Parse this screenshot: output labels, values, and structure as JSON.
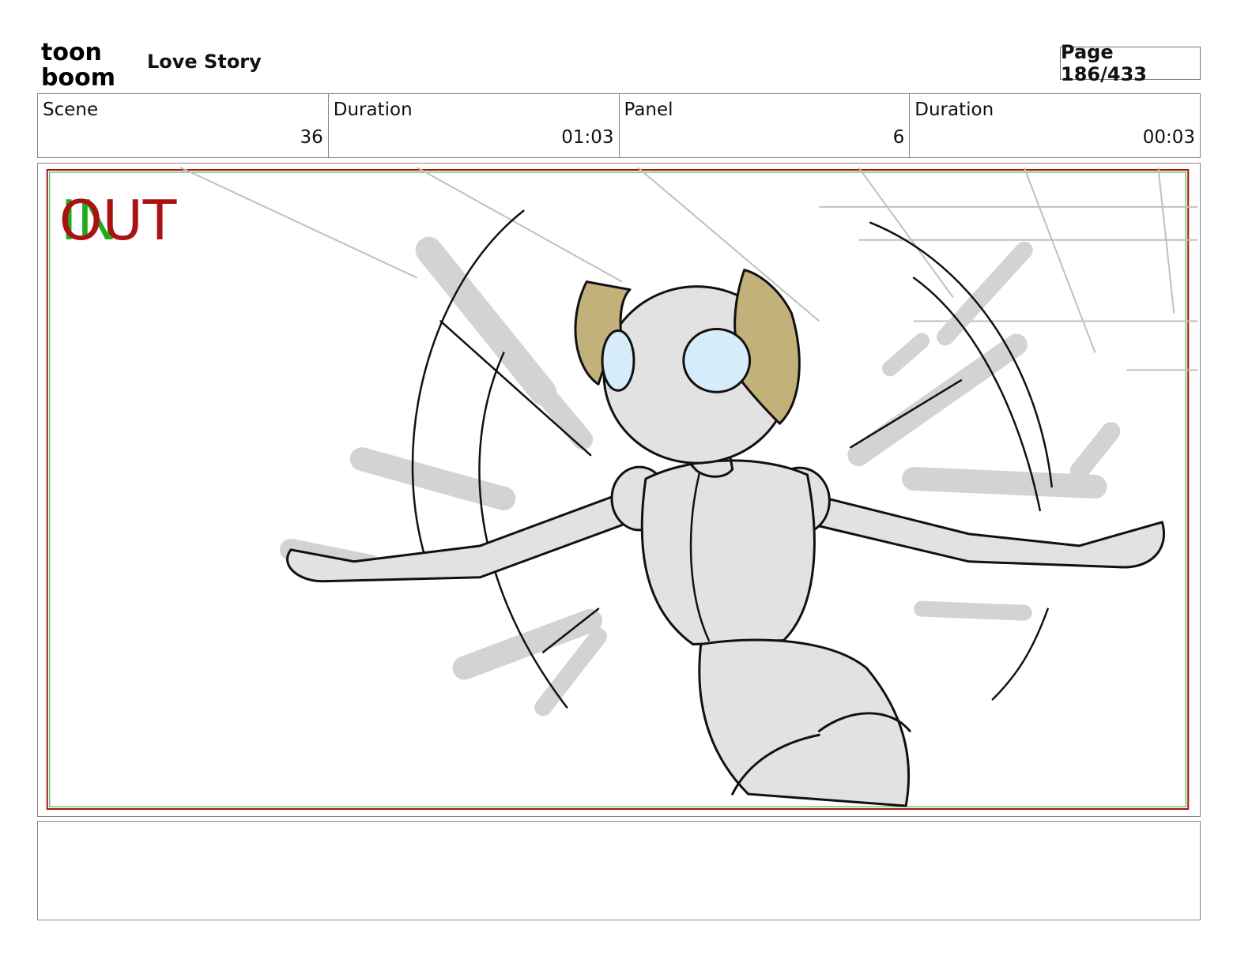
{
  "header": {
    "logo_top": "toon",
    "logo_bottom": "boom",
    "project_title": "Love Story",
    "page_label": "Page 186/433"
  },
  "info": {
    "scene_label": "Scene",
    "scene_value": "36",
    "scene_duration_label": "Duration",
    "scene_duration_value": "01:03",
    "panel_label": "Panel",
    "panel_value": "6",
    "panel_duration_label": "Duration",
    "panel_duration_value": "00:03"
  },
  "panel": {
    "marker_in": "IN",
    "marker_out": "OUT"
  },
  "caption": {
    "text": ""
  },
  "colors": {
    "in_marker": "#22aa22",
    "out_marker": "#aa1111",
    "hair": "#c2b27a",
    "eye": "#d6ecfb",
    "body": "#e2e2e2",
    "motion": "#d3d3d3"
  }
}
